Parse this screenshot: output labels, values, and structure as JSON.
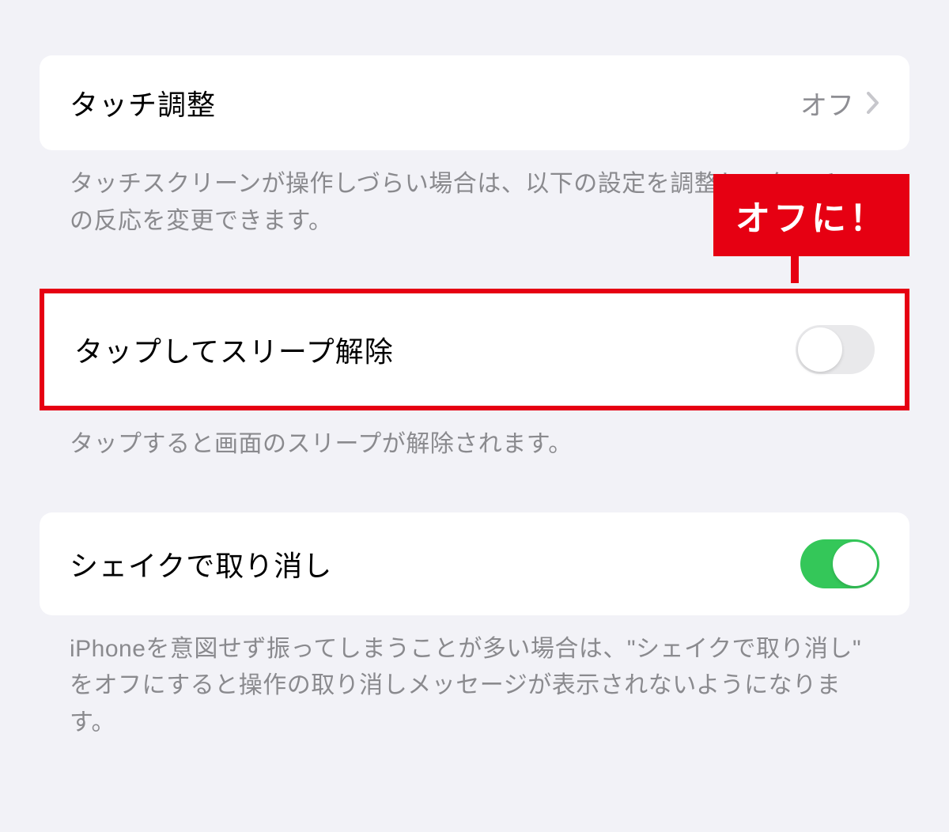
{
  "annotation": {
    "callout_text": "オフに！"
  },
  "sections": {
    "touch_accommodations": {
      "label": "タッチ調整",
      "value": "オフ",
      "footer": "タッチスクリーンが操作しづらい場合は、以下の設定を調整してタッチへの反応を変更できます。"
    },
    "tap_to_wake": {
      "label": "タップしてスリープ解除",
      "toggle_state": "off",
      "footer": "タップすると画面のスリープが解除されます。"
    },
    "shake_to_undo": {
      "label": "シェイクで取り消し",
      "toggle_state": "on",
      "footer": "iPhoneを意図せず振ってしまうことが多い場合は、\"シェイクで取り消し\" をオフにすると操作の取り消しメッセージが表示されないようになります。"
    }
  }
}
